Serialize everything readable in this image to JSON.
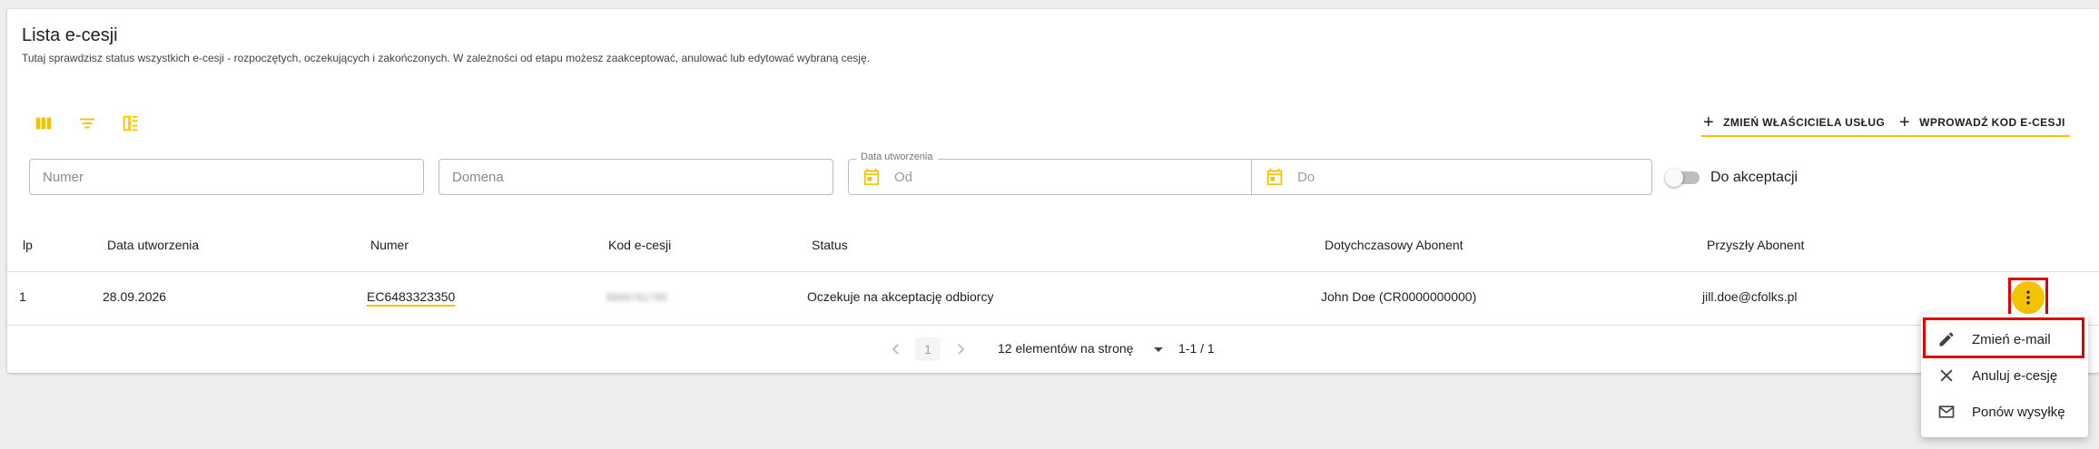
{
  "header": {
    "title": "Lista e-cesji",
    "subtitle": "Tutaj sprawdzisz status wszystkich e-cesji - rozpoczętych, oczekujących i zakończonych. W zależności od etapu możesz zaakceptować, anulować lub edytować wybraną cesję."
  },
  "toolbar": {
    "icons": [
      "columns-icon",
      "filter-icon",
      "density-icon"
    ],
    "change_owner_label": "ZMIEŃ WŁAŚCICIELA USŁUG",
    "enter_code_label": "WPROWADŹ KOD E-CESJI",
    "accent_color": "#f5c400"
  },
  "filters": {
    "number_placeholder": "Numer",
    "domain_placeholder": "Domena",
    "date_label": "Data utworzenia",
    "date_from_placeholder": "Od",
    "date_to_placeholder": "Do",
    "accept_toggle_label": "Do akceptacji",
    "accept_toggle_on": false
  },
  "table": {
    "columns": [
      "lp",
      "Data utworzenia",
      "Numer",
      "Kod e-cesji",
      "Status",
      "Dotychczasowy Abonent",
      "Przyszły Abonent"
    ],
    "rows": [
      {
        "lp": "1",
        "date": "28.09.2026",
        "number": "EC6483323350",
        "code": "8866761790",
        "status": "Oczekuje na akceptację odbiorcy",
        "current_subscriber": "John Doe (CR0000000000)",
        "future_subscriber": "jill.doe@cfolks.pl"
      }
    ]
  },
  "pagination": {
    "current_page": "1",
    "page_size_label": "12 elementów na stronę",
    "range": "1-1 / 1"
  },
  "context_menu": {
    "items": [
      {
        "label": "Zmień e-mail",
        "icon": "pencil-icon"
      },
      {
        "label": "Anuluj e-cesję",
        "icon": "close-icon"
      },
      {
        "label": "Ponów wysyłkę",
        "icon": "mail-icon"
      }
    ],
    "highlight_color": "#e00000"
  }
}
